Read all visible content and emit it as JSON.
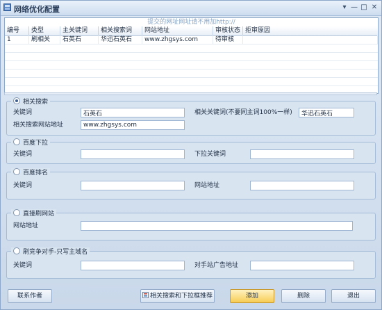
{
  "window": {
    "title": "网络优化配置",
    "controls": [
      "▾",
      "—",
      "□",
      "✕"
    ]
  },
  "grid": {
    "hint": "提交的网址网址请不用加http://",
    "columns": [
      "编号",
      "类型",
      "主关键词",
      "相关搜索词",
      "网站地址",
      "审核状态",
      "拒审原因"
    ],
    "rows": [
      [
        "1",
        "刷相关",
        "石英石",
        "华迅石英石",
        "www.zhgsys.com",
        "待审核",
        ""
      ]
    ]
  },
  "sections": {
    "related": {
      "title": "相关搜索",
      "selected": true,
      "keyword_label": "关键词",
      "keyword_value": "石英石",
      "related_label": "相关关键词(不要同主词100%一样)",
      "related_value": "华迅石英石",
      "url_label": "相关搜索网站地址",
      "url_value": "www.zhgsys.com"
    },
    "dropdown": {
      "title": "百度下拉",
      "selected": false,
      "keyword_label": "关键词",
      "keyword_value": "",
      "dropdown_label": "下拉关键词",
      "dropdown_value": ""
    },
    "ranking": {
      "title": "百度排名",
      "selected": false,
      "keyword_label": "关键词",
      "keyword_value": "",
      "url_label": "网站地址",
      "url_value": ""
    },
    "brush": {
      "title": "直接刷网站",
      "selected": false,
      "url_label": "网站地址",
      "url_value": ""
    },
    "competitor": {
      "title": "刷竞争对手-只写主域名",
      "selected": false,
      "keyword_label": "关键词",
      "keyword_value": "",
      "ad_label": "对手站广告地址",
      "ad_value": ""
    }
  },
  "buttons": {
    "contact": "联系作者",
    "recommend": "相关搜索和下拉框推荐",
    "add": "添加",
    "delete": "删除",
    "exit": "退出"
  },
  "colors": {
    "accent": "#f7cc54",
    "border": "#8ba6c8",
    "background": "#d9e4f1"
  }
}
